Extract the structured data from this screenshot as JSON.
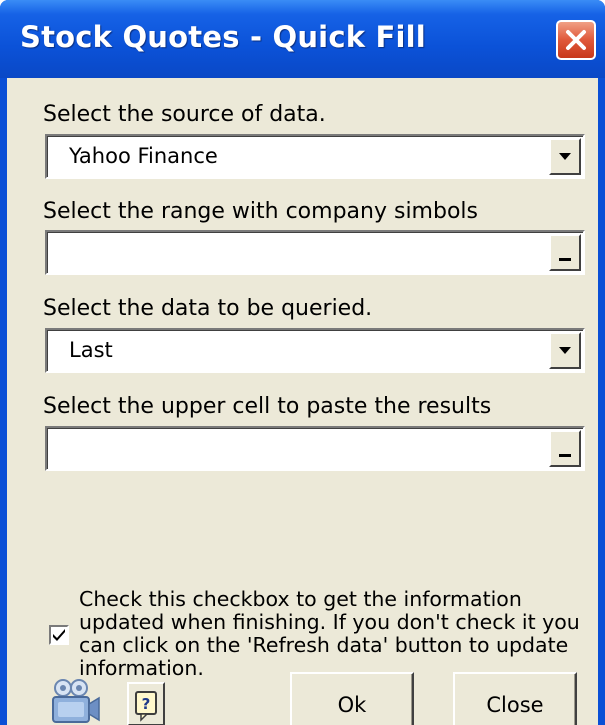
{
  "window": {
    "title": "Stock Quotes - Quick Fill"
  },
  "form": {
    "source": {
      "label": "Select the source of data.",
      "value": "Yahoo Finance"
    },
    "range": {
      "label": "Select the range with company simbols",
      "value": ""
    },
    "data": {
      "label": "Select the data to be queried.",
      "value": "Last"
    },
    "paste": {
      "label": "Select the upper cell to paste the results",
      "value": ""
    },
    "update_checkbox": {
      "checked": true,
      "text": "Check this checkbox to get the information updated when finishing. If you don't check it you can click on the 'Refresh data' button to update information."
    }
  },
  "buttons": {
    "ok": "Ok",
    "close": "Close"
  },
  "icons": {
    "video": "video-camera-icon",
    "help": "help-icon",
    "close": "close-icon",
    "dropdown": "dropdown-arrow-icon",
    "range_picker": "range-select-icon"
  },
  "colors": {
    "titlebar": "#0a52d8",
    "client": "#ece9d8",
    "close_button": "#e0583a"
  }
}
